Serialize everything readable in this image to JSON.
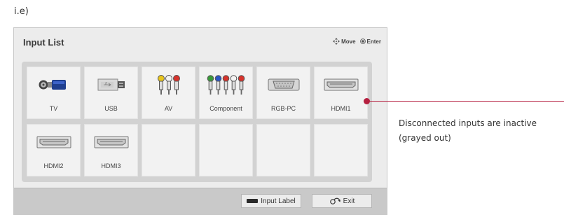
{
  "caption": "i.e)",
  "panel": {
    "title": "Input List",
    "hints": {
      "move_label": "Move",
      "enter_label": "Enter",
      "move_icon": "four-way-arrow-icon",
      "enter_icon": "ok-button-icon"
    }
  },
  "tiles": [
    {
      "label": "TV",
      "icon": "antenna-connector-icon"
    },
    {
      "label": "USB",
      "icon": "usb-drive-icon"
    },
    {
      "label": "AV",
      "icon": "av-rca-connectors-icon"
    },
    {
      "label": "Component",
      "icon": "component-rca-connectors-icon"
    },
    {
      "label": "RGB-PC",
      "icon": "vga-port-icon"
    },
    {
      "label": "HDMI1",
      "icon": "hdmi-port-icon"
    },
    {
      "label": "HDMI2",
      "icon": "hdmi-port-icon"
    },
    {
      "label": "HDMI3",
      "icon": "hdmi-port-icon"
    },
    {
      "label": "",
      "icon": ""
    },
    {
      "label": "",
      "icon": ""
    },
    {
      "label": "",
      "icon": ""
    },
    {
      "label": "",
      "icon": ""
    }
  ],
  "footer": {
    "input_label_button": "Input Label",
    "exit_button": "Exit",
    "input_label_key_color": "#2a2a2a",
    "exit_icon": "back-arrow-icon"
  },
  "callout": {
    "text": "Disconnected inputs are inactive (grayed out)",
    "color": "#b51f3f"
  }
}
